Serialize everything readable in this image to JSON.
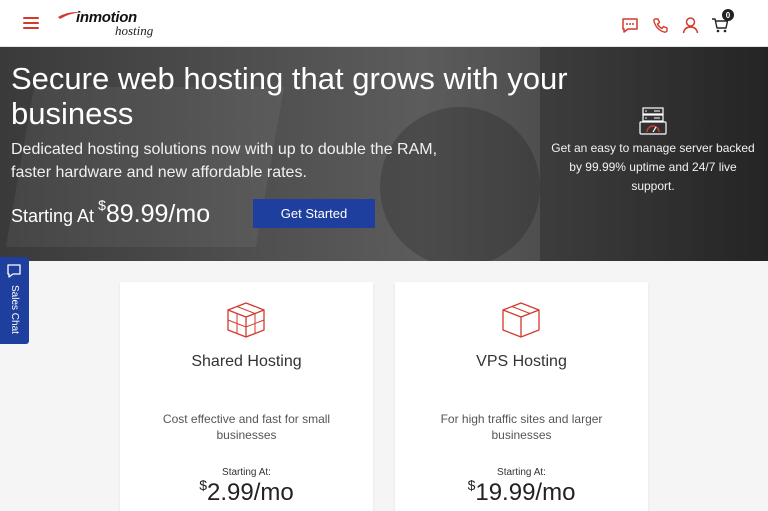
{
  "header": {
    "brand": "inmotion",
    "brand_sub": "hosting",
    "icons": [
      "menu-icon",
      "chat-icon",
      "phone-icon",
      "user-icon",
      "cart-icon"
    ],
    "cart_count": "0",
    "accent_color": "#d23a2d"
  },
  "hero": {
    "title": "Secure web hosting that grows with your business",
    "subtitle": "Dedicated hosting solutions now with up to double the RAM, faster hardware and new affordable rates.",
    "price_label": "Starting At",
    "price_currency": "$",
    "price_amount": "89.99/mo",
    "cta_label": "Get Started",
    "feature_text": "Get an easy to manage server backed by 99.99% uptime and 24/7 live support.",
    "cta_color": "#1e3f9e"
  },
  "sales_chat": {
    "label": "Sales Chat"
  },
  "cards": [
    {
      "title": "Shared Hosting",
      "description": "Cost effective and fast for small businesses",
      "starting_label": "Starting At:",
      "currency": "$",
      "price": "2.99/mo"
    },
    {
      "title": "VPS Hosting",
      "description": "For high traffic sites and larger businesses",
      "starting_label": "Starting At:",
      "currency": "$",
      "price": "19.99/mo"
    }
  ]
}
